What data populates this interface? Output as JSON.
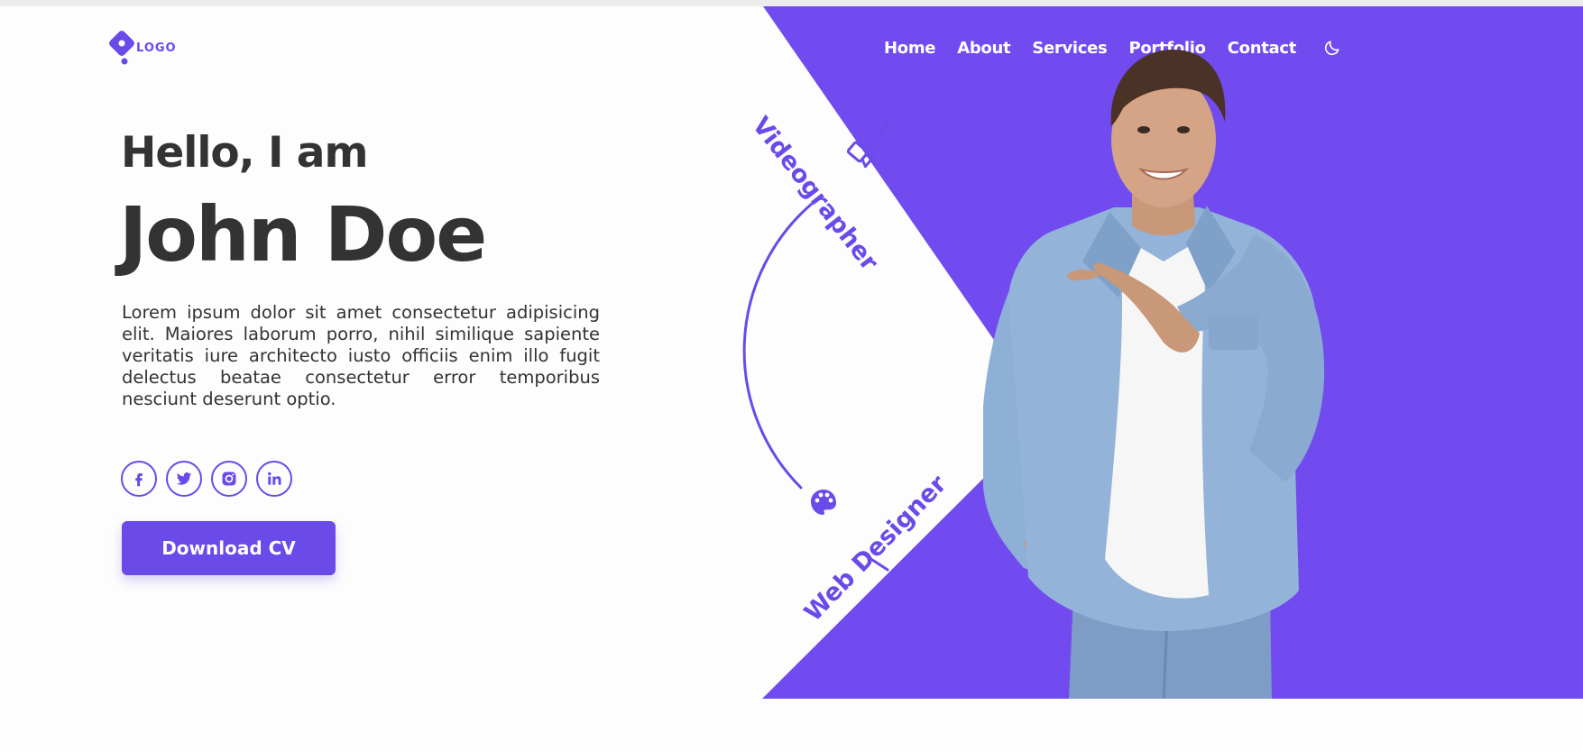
{
  "brand": {
    "logo_text": "LOGO",
    "accent_color": "#6a4ae8",
    "text_color": "#333333"
  },
  "nav": {
    "items": [
      "Home",
      "About",
      "Services",
      "Portfolio",
      "Contact"
    ],
    "theme_toggle_icon": "moon-icon"
  },
  "hero": {
    "greeting": "Hello, I am",
    "name": "John Doe",
    "description": "Lorem ipsum dolor sit amet consectetur adipisicing elit. Maiores laborum porro, nihil similique sapiente veritatis iure architecto iusto officiis enim illo fugit delectus beatae consectetur error temporibus nesciunt deserunt optio.",
    "socials": [
      "facebook-icon",
      "twitter-icon",
      "instagram-icon",
      "linkedin-icon"
    ],
    "cta_label": "Download CV"
  },
  "roles": {
    "top": "Videographer",
    "top_icon": "video-camera-icon",
    "bottom": "Web Designer",
    "bottom_icon": "palette-icon"
  }
}
